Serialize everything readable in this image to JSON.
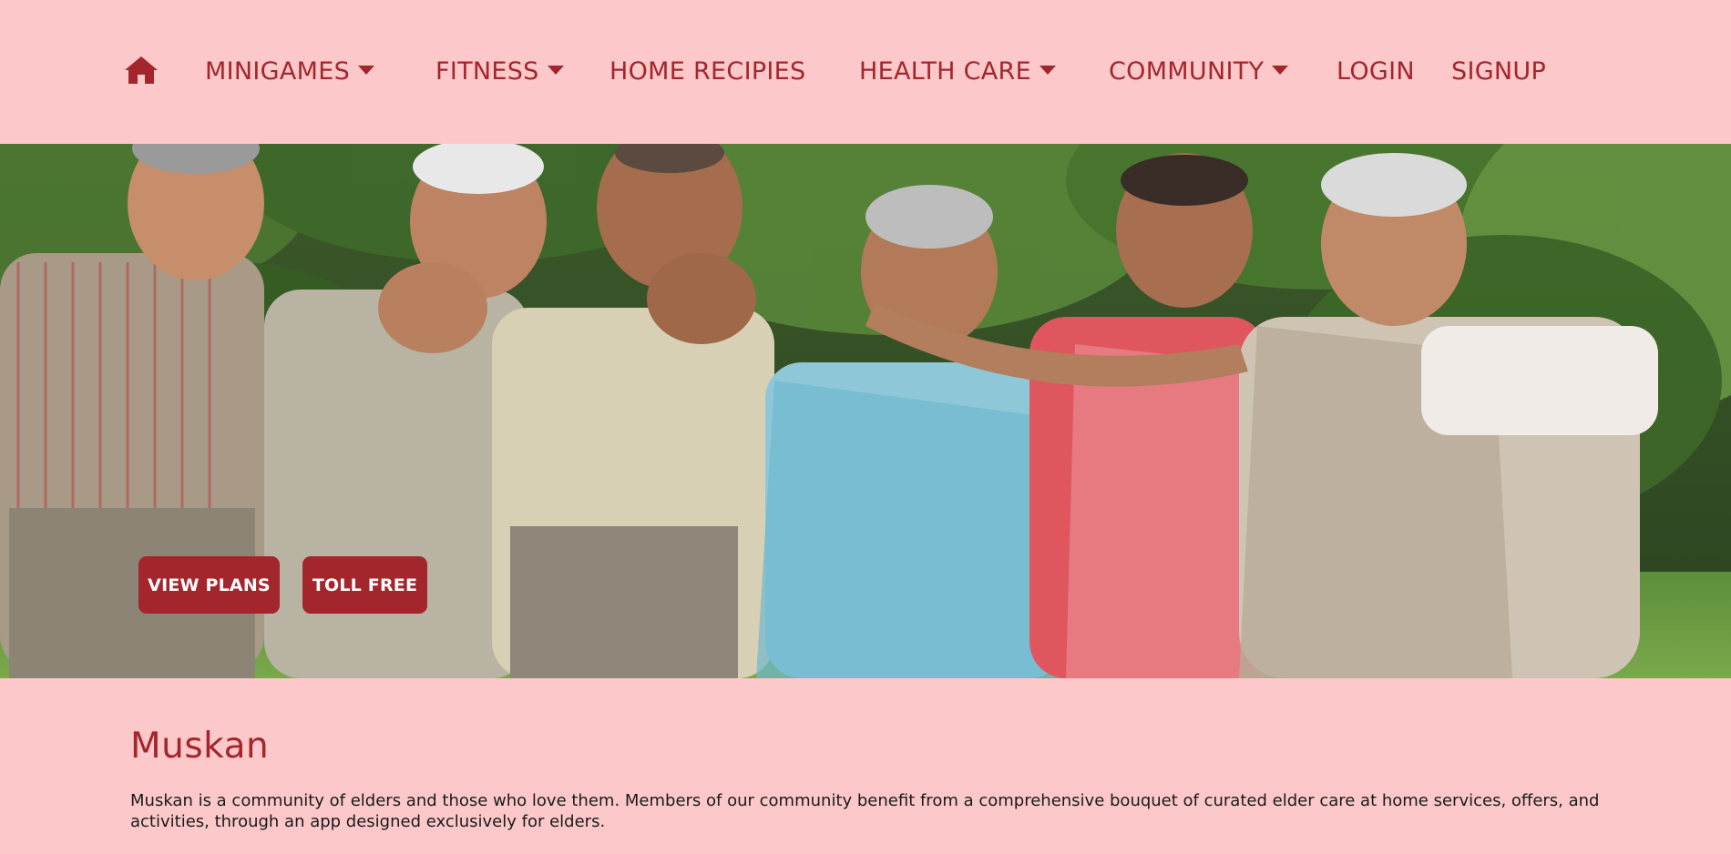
{
  "nav": {
    "home_icon": "home-icon",
    "items": [
      {
        "label": "MINIGAMES",
        "dropdown": true
      },
      {
        "label": "FITNESS",
        "dropdown": true
      },
      {
        "label": "HOME RECIPIES",
        "dropdown": false
      },
      {
        "label": "HEALTH CARE",
        "dropdown": true
      },
      {
        "label": "COMMUNITY",
        "dropdown": true
      },
      {
        "label": "LOGIN",
        "dropdown": false
      },
      {
        "label": "SIGNUP",
        "dropdown": false
      }
    ]
  },
  "hero": {
    "buttons": {
      "view_plans": "VIEW PLANS",
      "toll_free": "TOLL FREE"
    }
  },
  "about": {
    "title": "Muskan",
    "description": "Muskan is a community of elders and those who love them. Members of our community benefit from a comprehensive bouquet of curated elder care at home services, offers, and activities, through an app designed exclusively for elders."
  },
  "colors": {
    "background": "#fcc8c9",
    "accent": "#a3262c",
    "button_text": "#ffffff",
    "body_text": "#1a1a1a"
  }
}
